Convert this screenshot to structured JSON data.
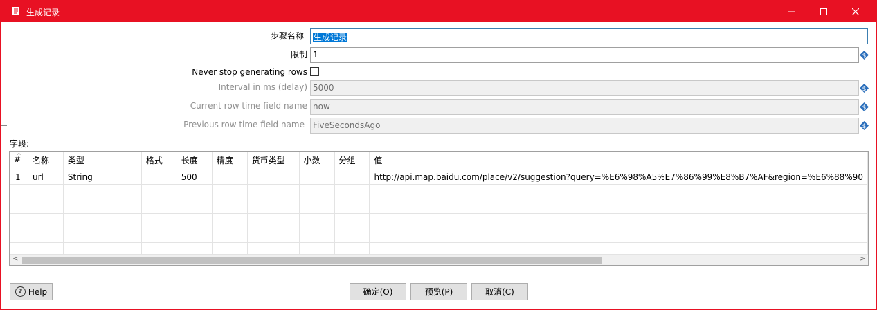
{
  "window": {
    "title": "生成记录"
  },
  "form": {
    "step_name_label": "步骤名称",
    "step_name_value": "生成记录",
    "limit_label": "限制",
    "limit_value": "1",
    "never_stop_label": "Never stop generating rows",
    "interval_label": "Interval in ms (delay)",
    "interval_value": "5000",
    "current_time_label": "Current row time field name",
    "current_time_value": "now",
    "previous_time_label": "Previous row time field name",
    "previous_time_value": "FiveSecondsAgo"
  },
  "fields": {
    "section_label": "字段:",
    "columns": [
      "#",
      "名称",
      "类型",
      "格式",
      "长度",
      "精度",
      "货币类型",
      "小数",
      "分组",
      "值"
    ],
    "rows": [
      {
        "num": "1",
        "name": "url",
        "type": "String",
        "format": "",
        "length": "500",
        "precision": "",
        "currency": "",
        "decimal": "",
        "group": "",
        "value": "http://api.map.baidu.com/place/v2/suggestion?query=%E6%98%A5%E7%86%99%E8%B7%AF&region=%E6%88%90"
      }
    ]
  },
  "buttons": {
    "help": "Help",
    "ok": "确定(O)",
    "preview": "预览(P)",
    "cancel": "取消(C)"
  },
  "icons": {
    "title": "document-icon",
    "variable": "variable-dollar-icon"
  },
  "colors": {
    "titlebar": "#e81123",
    "selection": "#0078d7",
    "variable_icon": "#2a6ebb"
  }
}
